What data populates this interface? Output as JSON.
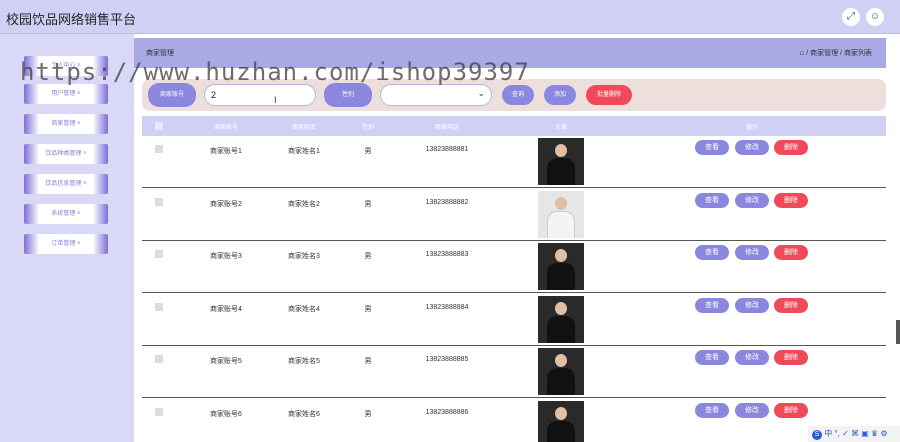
{
  "app": {
    "title": "校园饮品网络销售平台"
  },
  "header_icons": {
    "fullscreen": "fullscreen-icon",
    "user": "user-icon"
  },
  "sidebar": {
    "items": [
      {
        "label": "个人中心 ˅"
      },
      {
        "label": "用户管理 ˅"
      },
      {
        "label": "商家管理 ˅"
      },
      {
        "label": "饮品种类管理 ˅"
      },
      {
        "label": "饮品信息管理 ˅"
      },
      {
        "label": "系统管理 ˅"
      },
      {
        "label": "订单管理 ˅"
      }
    ]
  },
  "breadcrumb": {
    "title": "商家管理",
    "path": "/ 商家管理 / 商家列表",
    "home_icon": "⌂"
  },
  "search": {
    "field_label": "商家账号",
    "input_value": "2",
    "gender_label": "性别",
    "select_value": "",
    "query_button": "查询",
    "add_button": "添加",
    "batch_delete_button": "批量删除"
  },
  "table": {
    "headers": [
      "商家账号",
      "商家姓名",
      "性别",
      "商家电话",
      "头像",
      "操作"
    ],
    "rows": [
      {
        "account": "商家账号1",
        "name": "商家姓名1",
        "gender": "男",
        "phone": "13823888881"
      },
      {
        "account": "商家账号2",
        "name": "商家姓名2",
        "gender": "男",
        "phone": "13823888882"
      },
      {
        "account": "商家账号3",
        "name": "商家姓名3",
        "gender": "男",
        "phone": "13823888883"
      },
      {
        "account": "商家账号4",
        "name": "商家姓名4",
        "gender": "男",
        "phone": "13823888884"
      },
      {
        "account": "商家账号5",
        "name": "商家姓名5",
        "gender": "男",
        "phone": "13823888885"
      },
      {
        "account": "商家账号6",
        "name": "商家姓名6",
        "gender": "男",
        "phone": "13823888886"
      }
    ],
    "actions": {
      "view": "查看",
      "edit": "修改",
      "delete": "删除"
    }
  },
  "watermark": "https://www.huzhan.com/ishop39397",
  "tray": {
    "text": "中 °, ✓ ⌘ ▣ ♛ ⚙",
    "badge": "S"
  },
  "colors": {
    "accent": "#8b87de",
    "danger": "#f04a5a",
    "header": "#cfd0f4"
  }
}
